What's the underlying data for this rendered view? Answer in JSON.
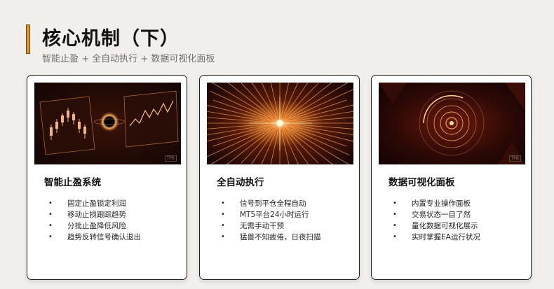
{
  "header": {
    "title": "核心机制（下）",
    "subtitle": "智能止盈 + 全自动执行 + 数据可视化面板"
  },
  "cards": [
    {
      "title": "智能止盈系统",
      "image_icon": "candlestick-blackhole-image",
      "watermark": "TPB",
      "bullets": [
        "固定止盈锁定利润",
        "移动止损跟踪趋势",
        "分批止盈降低风险",
        "趋势反转信号确认退出"
      ]
    },
    {
      "title": "全自动执行",
      "image_icon": "light-burst-image",
      "watermark": "",
      "bullets": [
        "信号到平仓全程自动",
        "MT5平台24小时运行",
        "无需手动干预",
        "猛兽不知疲倦，日夜扫描"
      ]
    },
    {
      "title": "数据可视化面板",
      "image_icon": "concentric-rings-dashboard-image",
      "watermark": "TPB",
      "bullets": [
        "内置专业操作面板",
        "交易状态一目了然",
        "量化数据可视化展示",
        "实时掌握EA运行状况"
      ]
    }
  ],
  "colors": {
    "accent": "#e0962a",
    "card_border": "#222222",
    "background": "#f1eeeb"
  }
}
